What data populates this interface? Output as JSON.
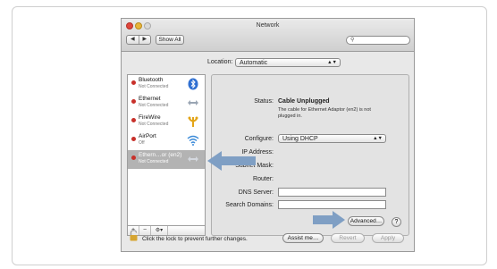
{
  "window": {
    "title": "Network",
    "show_all": "Show All",
    "nav_back": "◀",
    "nav_fwd": "▶",
    "search_icon": "magnifier"
  },
  "location": {
    "label": "Location:",
    "value": "Automatic"
  },
  "services": [
    {
      "name": "Bluetooth",
      "status": "Not Connected",
      "icon": "bluetooth-icon"
    },
    {
      "name": "Ethernet",
      "status": "Not Connected",
      "icon": "ethernet-arrows-icon"
    },
    {
      "name": "FireWire",
      "status": "Not Connected",
      "icon": "firewire-icon"
    },
    {
      "name": "AirPort",
      "status": "Off",
      "icon": "wifi-icon"
    },
    {
      "name": "Ethern…or (en2)",
      "status": "Not Connected",
      "icon": "ethernet-arrows-icon"
    }
  ],
  "sidebar_controls": {
    "add": "+",
    "remove": "−",
    "gear": "⚙▾"
  },
  "detail": {
    "status_label": "Status:",
    "status_value": "Cable Unplugged",
    "status_note": "The cable for Ethernet Adaptor (en2) is not plugged in.",
    "configure_label": "Configure:",
    "configure_value": "Using DHCP",
    "ip_label": "IP Address:",
    "subnet_label": "Subnet Mask:",
    "router_label": "Router:",
    "dns_label": "DNS Server:",
    "search_domains_label": "Search Domains:",
    "advanced": "Advanced…",
    "help": "?"
  },
  "footer": {
    "lock_text": "Click the lock to prevent further changes.",
    "assist": "Assist me…",
    "revert": "Revert",
    "apply": "Apply"
  },
  "colors": {
    "arrow": "#7f9fc4",
    "status_dot": "#c8302a",
    "selected_row": "#b3b3b3"
  }
}
